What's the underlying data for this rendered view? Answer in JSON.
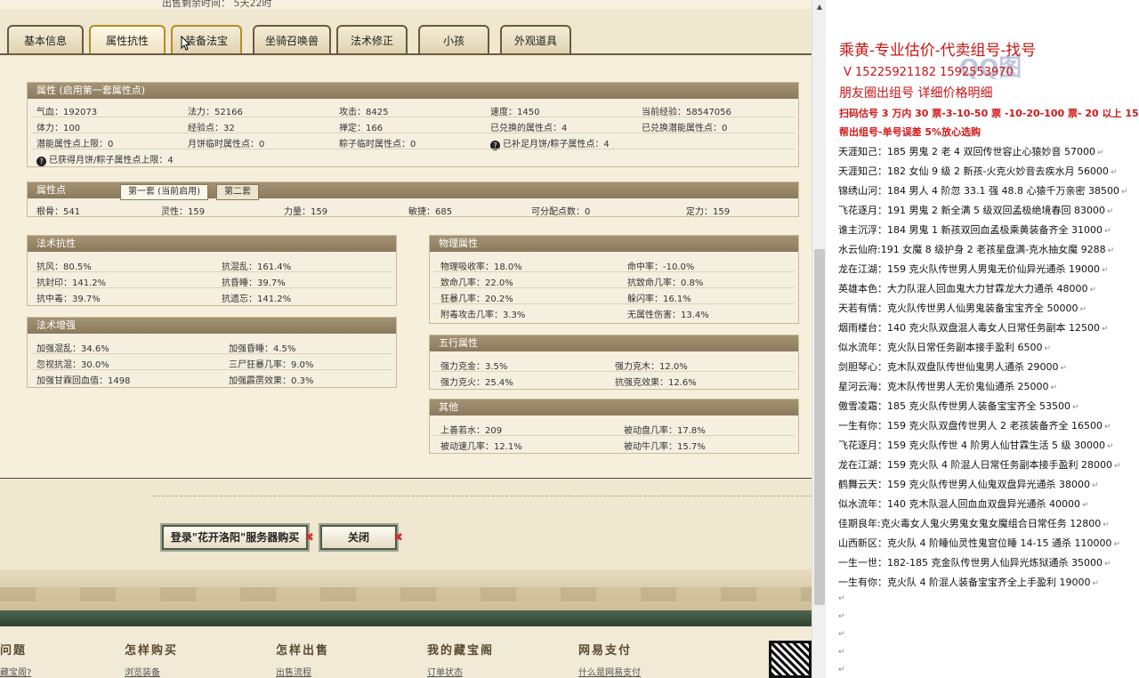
{
  "top_text": "出售剩余时间：  5天22时",
  "tabs": [
    "基本信息",
    "属性抗性",
    "装备法宝",
    "坐骑召唤兽",
    "法术修正",
    "小孩",
    "外观道具"
  ],
  "attrs_box": {
    "title": "属性 (启用第一套属性点)",
    "rows": [
      [
        "气血：192073",
        "法力：52166",
        "攻击：8425",
        "速度：1450",
        "当前经验：58547056"
      ],
      [
        "体力：100",
        "经验点：32",
        "禅定：166",
        "已兑换的属性点：4",
        "已兑换潜能属性点：0"
      ],
      [
        "潜能属性点上限：0",
        "月饼临时属性点：0",
        "粽子临时属性点：0",
        "已补足月饼/粽子属性点：4",
        ""
      ],
      [
        "已获得月饼/粽子属性点上限：4",
        "",
        "",
        "",
        ""
      ]
    ]
  },
  "points_box": {
    "title": "属性点",
    "subtabs": [
      "第一套 (当前启用)",
      "第二套"
    ],
    "values": [
      "根骨：541",
      "灵性：159",
      "力量：159",
      "敏捷：685",
      "可分配点数：0",
      "定力：159"
    ]
  },
  "resist_box": {
    "title": "法术抗性",
    "rows": [
      [
        "抗风：80.5%",
        "抗混乱：161.4%"
      ],
      [
        "抗封印：141.2%",
        "抗昏睡：39.7%"
      ],
      [
        "抗中毒：39.7%",
        "抗遗忘：141.2%"
      ]
    ]
  },
  "enhance_box": {
    "title": "法术增强",
    "rows": [
      [
        "加强混乱：34.6%",
        "加强昏睡：4.5%"
      ],
      [
        "忽视抗混：30.0%",
        "三尸狂暴几率：9.0%"
      ],
      [
        "加强甘霖回血值：1498",
        "加强霹雳效果：0.3%"
      ]
    ]
  },
  "physical_box": {
    "title": "物理属性",
    "rows": [
      [
        "物理吸收率：18.0%",
        "命中率：-10.0%"
      ],
      [
        "致命几率：22.0%",
        "抗致命几率：0.8%"
      ],
      [
        "狂暴几率：20.2%",
        "躲闪率：16.1%"
      ],
      [
        "附毒攻击几率：3.3%",
        "无属性伤害：13.4%"
      ]
    ]
  },
  "five_box": {
    "title": "五行属性",
    "rows": [
      [
        "强力克金：3.5%",
        "强力克木：12.0%"
      ],
      [
        "强力克火：25.4%",
        "抗强克效果：12.6%"
      ]
    ]
  },
  "other_box": {
    "title": "其他",
    "rows": [
      [
        "上善若水：209",
        "被动盘几率：17.8%"
      ],
      [
        "被动速几率：12.1%",
        "被动牛几率：15.7%"
      ]
    ]
  },
  "buttons": {
    "buy": "登录\"花开洛阳\"服务器购买",
    "close": "关闭"
  },
  "footer": [
    {
      "head": "问题",
      "link": "藏宝阁?"
    },
    {
      "head": "怎样购买",
      "link": "浏览装备"
    },
    {
      "head": "怎样出售",
      "link": "出售流程"
    },
    {
      "head": "我的藏宝阁",
      "link": "订单状态"
    },
    {
      "head": "网易支付",
      "link": "什么是网易支付"
    }
  ],
  "right": {
    "title": "乘黄-专业估价-代卖组号-找号",
    "phone": "V 15225921182   1592553970",
    "watermark": "QQ图",
    "subtitle": "朋友圈出组号    详细价格明细",
    "price": "扫码估号 3 万内 30 票-3-10-50 票  -10-20-100 票- 20 以上 150",
    "note": "帮出组号-单号误差 5%放心选购",
    "listings": [
      "天涯知己：185 男鬼 2 老 4 双回传世容止心猿妙音 57000",
      "天涯知己：182 女仙 9 级 2 新孩-火克火妙音去疾水月 56000",
      "锦绣山河：184 男人 4 阶忽 33.1 强 48.8 心猿千万亲密 38500",
      "飞花逐月：191 男鬼 2 新全满 5 级双回孟极绝境春回 83000",
      "谁主沉浮：184 男鬼 1 新孩双回血孟极乘黄装备齐全 31000",
      "水云仙府:191 女魔 8 级护身 2 老孩星盘满-克水抽女魔 9288",
      "龙在江湖：159 克火队传世男人男鬼无价仙异光通杀 19000",
      "英雄本色：大力队混人回血鬼大力甘霖龙大力通杀 48000",
      "天若有情：克火队传世男人仙男鬼装备宝宝齐全 50000",
      "烟雨楼台：140 克火队双盘混人毒女人日常任务副本 12500",
      "似水流年：克火队日常任务副本接手盈利 6500",
      "剑胆琴心：克木队双盘队传世仙鬼男人通杀 29000",
      "星河云海：克木队传世男人无价鬼仙通杀 25000",
      "傲雪凌霜：185 克火队传世男人装备宝宝齐全 53500",
      "一生有你：159 克火队双盘传世男人 2 老孩装备齐全 16500",
      "飞花逐月：159 克火队传世 4 阶男人仙甘霖生活 5 级 30000",
      "龙在江湖：159 克火队 4 阶混人日常任务副本接手盈利 28000",
      "鹤舞云天：159 克火队传世男人仙鬼双盘异光通杀 38000",
      "似水流年：140 克木队混人回血血双盘异光通杀 40000",
      "佳期良年:克火毒女人鬼火男鬼女鬼女魔组合日常任务 12800",
      "山西新区：克火队 4 阶睡仙灵性鬼宫位睡 14-15 通杀 110000",
      "一生一世：182-185 克金队传世男人仙异光炼狱通杀 35000",
      "一生有你：克火队 4 阶混人装备宝宝齐全上手盈利 19000"
    ]
  }
}
